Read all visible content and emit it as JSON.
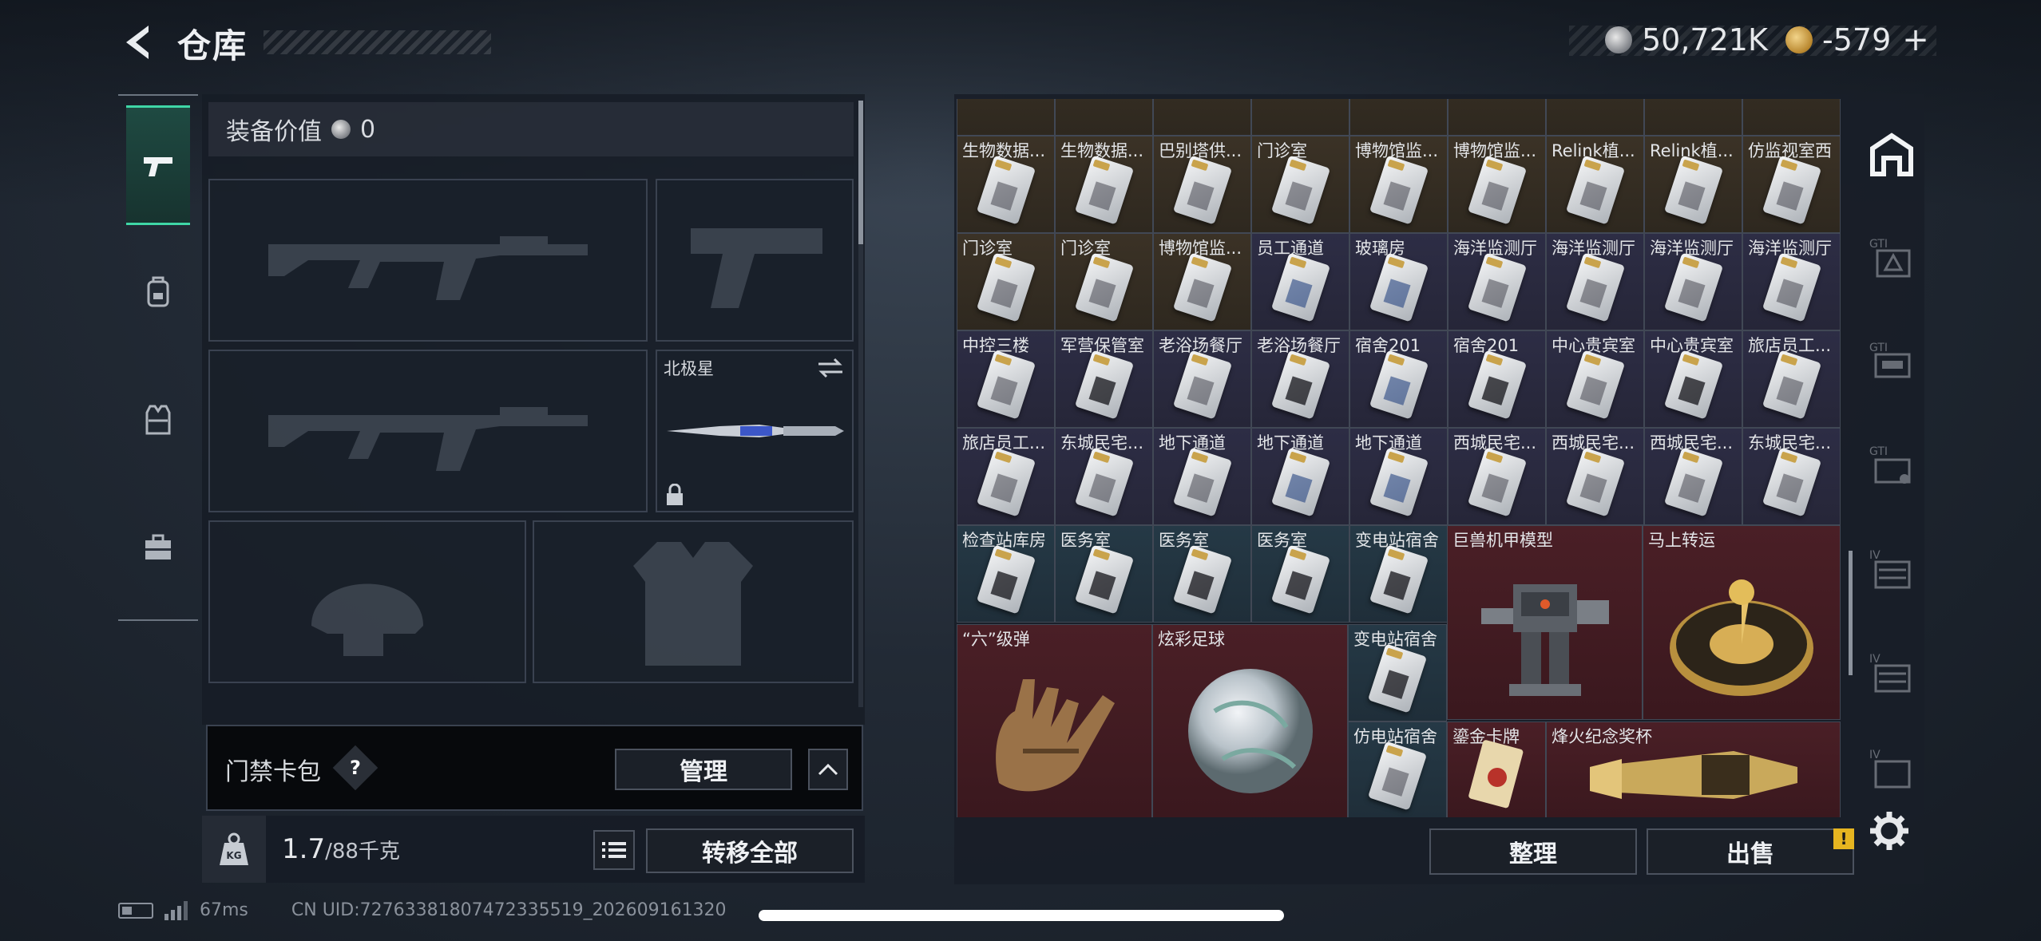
{
  "header": {
    "title": "仓库",
    "currency1": "50,721K",
    "currency2": "-579",
    "plus": "+"
  },
  "nav": {
    "items": [
      "weapons-icon",
      "backpack-icon",
      "vest-icon",
      "toolbox-icon"
    ]
  },
  "equipment": {
    "value_label": "装备价值",
    "value": "0",
    "melee_label": "北极星"
  },
  "card_pack": {
    "label": "门禁卡包",
    "help": "?",
    "manage": "管理"
  },
  "weight": {
    "current": "1.7",
    "max": "/88千克",
    "transfer_all": "转移全部"
  },
  "storage": {
    "sort": "整理",
    "sell": "出售",
    "warn": "!",
    "rows": [
      {
        "names": [
          "生物数据...",
          "生物数据...",
          "巴别塔供...",
          "门诊室",
          "博物馆监...",
          "博物馆监...",
          "Relink植...",
          "Relink植...",
          "仿监视室西"
        ],
        "colors": [
          "brown",
          "brown",
          "brown",
          "brown",
          "brown",
          "brown",
          "brown",
          "brown",
          "brown"
        ]
      },
      {
        "names": [
          "门诊室",
          "门诊室",
          "博物馆监...",
          "员工通道",
          "玻璃房",
          "海洋监测厅",
          "海洋监测厅",
          "海洋监测厅",
          "海洋监测厅"
        ],
        "colors": [
          "brown",
          "brown",
          "brown",
          "purple",
          "purple",
          "purple",
          "purple",
          "purple",
          "purple"
        ]
      },
      {
        "names": [
          "中控三楼",
          "军营保管室",
          "老浴场餐厅",
          "老浴场餐厅",
          "宿舍201",
          "宿舍201",
          "中心贵宾室",
          "中心贵宾室",
          "旅店员工..."
        ],
        "colors": [
          "purple",
          "purple",
          "purple",
          "purple",
          "purple",
          "purple",
          "purple",
          "purple",
          "purple"
        ]
      },
      {
        "names": [
          "旅店员工...",
          "东城民宅...",
          "地下通道",
          "地下通道",
          "地下通道",
          "西城民宅...",
          "西城民宅...",
          "西城民宅...",
          "东城民宅..."
        ],
        "colors": [
          "purple",
          "purple",
          "purple",
          "purple",
          "purple",
          "purple",
          "purple",
          "purple",
          "purple"
        ]
      },
      {
        "names": [
          "检查站库房",
          "医务室",
          "医务室",
          "医务室",
          "变电站宿舍"
        ],
        "colors": [
          "teal",
          "teal",
          "teal",
          "teal",
          "teal"
        ]
      }
    ],
    "big_items": {
      "mech": "巨兽机甲模型",
      "wheel": "马上转运",
      "six": "“六”级弹",
      "ball": "炫彩足球",
      "sub1": "变电站宿舍",
      "sub2": "仿电站宿舍",
      "gold_card": "鎏金卡牌",
      "trophy": "烽火纪念奖杯"
    }
  },
  "status": {
    "ping": "67ms",
    "uid": "CN UID:7276338180747233551​9_202609161320"
  }
}
